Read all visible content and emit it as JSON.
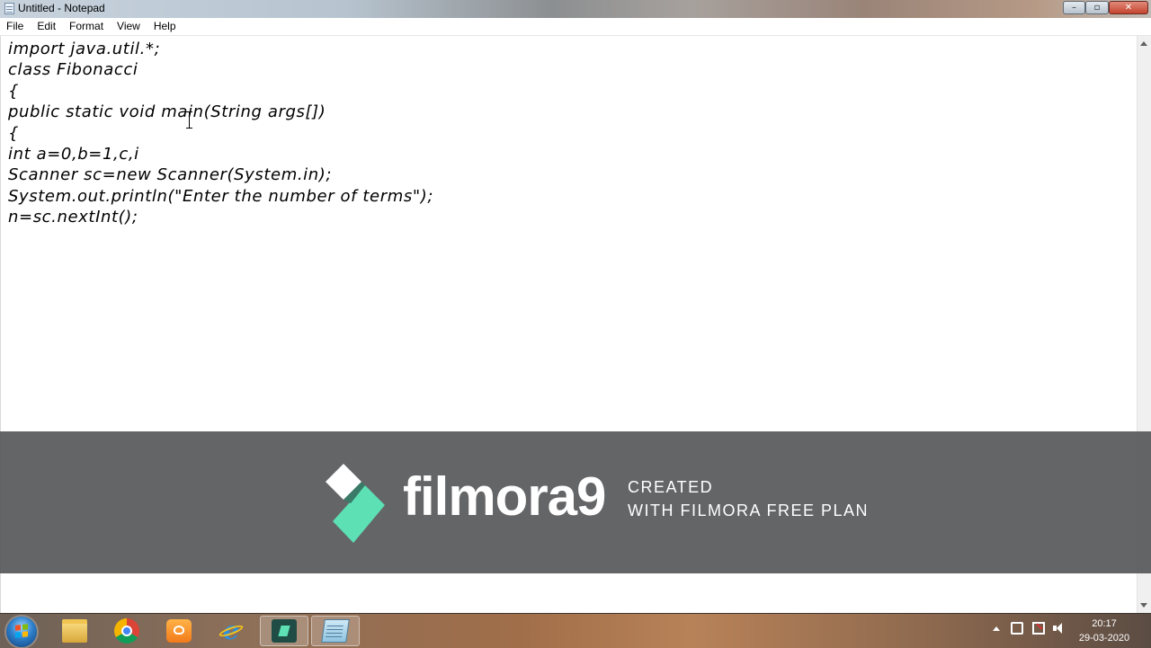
{
  "window": {
    "title": "Untitled - Notepad",
    "min_label": "–",
    "max_label": "▫",
    "close_label": "✕"
  },
  "menu": [
    "File",
    "Edit",
    "Format",
    "View",
    "Help"
  ],
  "editor": {
    "lines": [
      "import java.util.*;",
      "class Fibonacci",
      "{",
      "public static void main(String args[])",
      "{",
      "int a=0,b=1,c,i",
      "Scanner sc=new Scanner(System.in);",
      "System.out.println(\"Enter the number of terms\");",
      "n=sc.nextInt();"
    ]
  },
  "watermark": {
    "wordmark": "filmora9",
    "line1": "CREATED",
    "line2": "WITH FILMORA FREE PLAN",
    "accent_color": "#5de0b3"
  },
  "taskbar": {
    "apps": [
      {
        "name": "windows-explorer",
        "icon": "folder-icon",
        "active": false
      },
      {
        "name": "google-chrome",
        "icon": "chrome-icon",
        "active": false
      },
      {
        "name": "uc-browser",
        "icon": "uc-browser-icon",
        "active": false
      },
      {
        "name": "internet-explorer",
        "icon": "ie-icon",
        "active": false
      },
      {
        "name": "filmora",
        "icon": "filmora-icon",
        "active": true
      },
      {
        "name": "notepad",
        "icon": "notepad-icon",
        "active": true
      }
    ],
    "clock": {
      "time": "20:17",
      "date": "29-03-2020"
    }
  }
}
